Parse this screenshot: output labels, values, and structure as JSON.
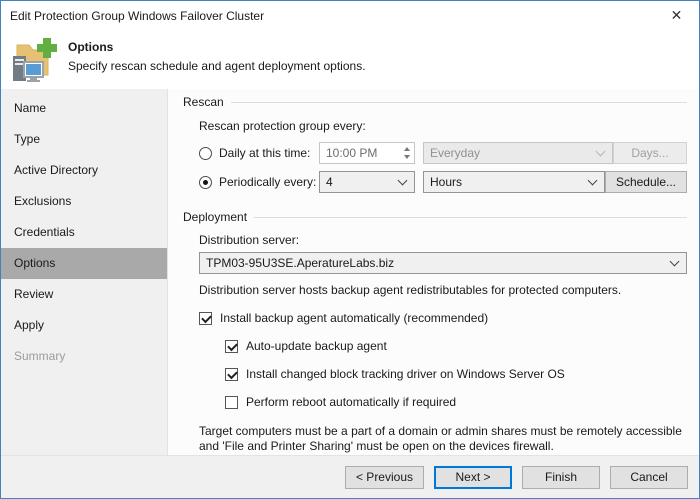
{
  "window": {
    "title": "Edit Protection Group Windows Failover Cluster",
    "close_glyph": "✕"
  },
  "banner": {
    "title": "Options",
    "subtitle": "Specify rescan schedule and agent deployment options."
  },
  "sidebar": {
    "items": [
      {
        "label": "Name",
        "state": "enabled"
      },
      {
        "label": "Type",
        "state": "enabled"
      },
      {
        "label": "Active Directory",
        "state": "enabled"
      },
      {
        "label": "Exclusions",
        "state": "enabled"
      },
      {
        "label": "Credentials",
        "state": "enabled"
      },
      {
        "label": "Options",
        "state": "selected"
      },
      {
        "label": "Review",
        "state": "enabled"
      },
      {
        "label": "Apply",
        "state": "enabled"
      },
      {
        "label": "Summary",
        "state": "disabled"
      }
    ]
  },
  "rescan": {
    "group_label": "Rescan",
    "heading": "Rescan protection group every:",
    "daily": {
      "label": "Daily at this time:",
      "selected": false,
      "time_value": "10:00 PM",
      "day_option": "Everyday",
      "days_button": "Days..."
    },
    "periodic": {
      "label": "Periodically every:",
      "selected": true,
      "interval_value": "4",
      "unit_value": "Hours",
      "schedule_button": "Schedule..."
    }
  },
  "deployment": {
    "group_label": "Deployment",
    "server_label": "Distribution server:",
    "server_value": "TPM03-95U3SE.AperatureLabs.biz",
    "server_note": "Distribution server hosts backup agent redistributables for protected computers.",
    "checkboxes": [
      {
        "label": "Install backup agent automatically (recommended)",
        "checked": true,
        "indent": false
      },
      {
        "label": "Auto-update backup agent",
        "checked": true,
        "indent": true
      },
      {
        "label": "Install changed block tracking driver on Windows Server OS",
        "checked": true,
        "indent": true
      },
      {
        "label": "Perform reboot automatically if required",
        "checked": false,
        "indent": true
      }
    ],
    "footnote": "Target computers must be a part of a domain or admin shares must be remotely accessible and 'File and Printer Sharing' must be open on the devices firewall."
  },
  "footer": {
    "previous": "< Previous",
    "next": "Next >",
    "finish": "Finish",
    "cancel": "Cancel"
  },
  "colors": {
    "window_border": "#4282c4",
    "default_button_border": "#0078d7",
    "selected_nav_bg": "#a9a9a9",
    "sidebar_bg": "#f0f0f0",
    "icon_folder": "#e6c173",
    "icon_plus_green": "#61ae41",
    "icon_screen_blue": "#5b9bd5"
  }
}
